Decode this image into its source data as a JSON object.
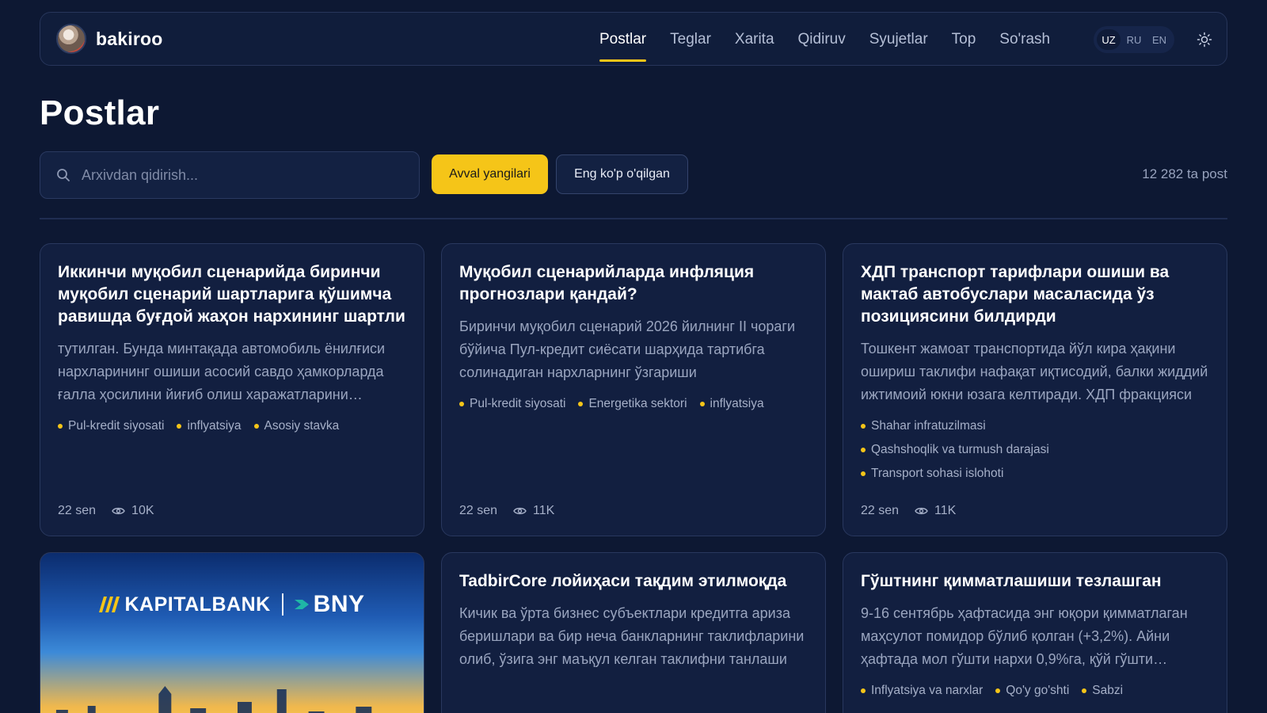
{
  "header": {
    "brand": "bakiroo",
    "nav": [
      {
        "label": "Postlar",
        "active": true
      },
      {
        "label": "Teglar",
        "active": false
      },
      {
        "label": "Xarita",
        "active": false
      },
      {
        "label": "Qidiruv",
        "active": false
      },
      {
        "label": "Syujetlar",
        "active": false
      },
      {
        "label": "Top",
        "active": false
      },
      {
        "label": "So'rash",
        "active": false
      }
    ],
    "languages": [
      {
        "code": "UZ",
        "active": true
      },
      {
        "code": "RU",
        "active": false
      },
      {
        "code": "EN",
        "active": false
      }
    ],
    "theme_icon": "sun-icon"
  },
  "page": {
    "title": "Postlar",
    "search_placeholder": "Arxivdan qidirish...",
    "sort_newest": "Avval yangilari",
    "sort_most_read": "Eng ko'p o'qilgan",
    "post_count": "12 282 ta post"
  },
  "colors": {
    "background": "#0d1833",
    "accent": "#f5c518",
    "card": "#121f40"
  },
  "cards": [
    {
      "title": "Иккинчи муқобил сценарийда биринчи муқобил сценарий шартларига қўшимча равишда буғдой жаҳон нархининг шартли",
      "excerpt": "тутилган. Бунда минтақада автомобиль ёнилғиси нархларининг ошиши асосий савдо ҳамкорларда ғалла ҳосилини йиғиб олиш харажатларини оширади",
      "tags": [
        "Pul-kredit siyosati",
        "inflyatsiya",
        "Asosiy stavka"
      ],
      "date": "22 sen",
      "views": "10K"
    },
    {
      "title": "Муқобил сценарийларда инфляция прогнозлари қандай?",
      "excerpt": "Биринчи муқобил сценарий 2026 йилнинг II чораги бўйича Пул-кредит сиёсати шарҳида тартибга солинадиган нархларнинг ўзгариши",
      "tags": [
        "Pul-kredit siyosati",
        "Energetika sektori",
        "inflyatsiya"
      ],
      "date": "22 sen",
      "views": "11K"
    },
    {
      "title": "ХДП транспорт тарифлари ошиши ва мактаб автобуслари масаласида ўз позициясини билдирди",
      "excerpt": "Тошкент жамоат транспортида йўл кира ҳақини ошириш таклифи нафақат иқтисодий, балки жиддий ижтимоий юкни юзага келтиради. ХДП фракцияси",
      "tags": [
        "Shahar infratuzilmasi",
        "Qashshoqlik va turmush darajasi",
        "Transport sohasi islohoti"
      ],
      "date": "22 sen",
      "views": "11K"
    },
    {
      "image": true,
      "logo_left": "KAPITALBANK",
      "logo_right": "BNY"
    },
    {
      "title": "TadbirCore лойиҳаси тақдим этилмоқда",
      "excerpt": "Кичик ва ўрта бизнес субъектлари кредитга ариза беришлари ва бир неча банкларнинг таклифларини олиб, ўзига энг маъқул келган таклифни танлаши",
      "tags": [],
      "date": "",
      "views": ""
    },
    {
      "title": "Гўштнинг қимматлашиши тезлашган",
      "excerpt": "9-16 сентябрь ҳафтасида энг юқори қимматлаган маҳсулот помидор бўлиб қолган (+3,2%). Айни ҳафтада мол гўшти нархи 0,9%га, қўй гўшти қимматлаган",
      "tags": [
        "Inflyatsiya va narxlar",
        "Qo'y go'shti",
        "Sabzi"
      ],
      "date": "",
      "views": ""
    }
  ]
}
